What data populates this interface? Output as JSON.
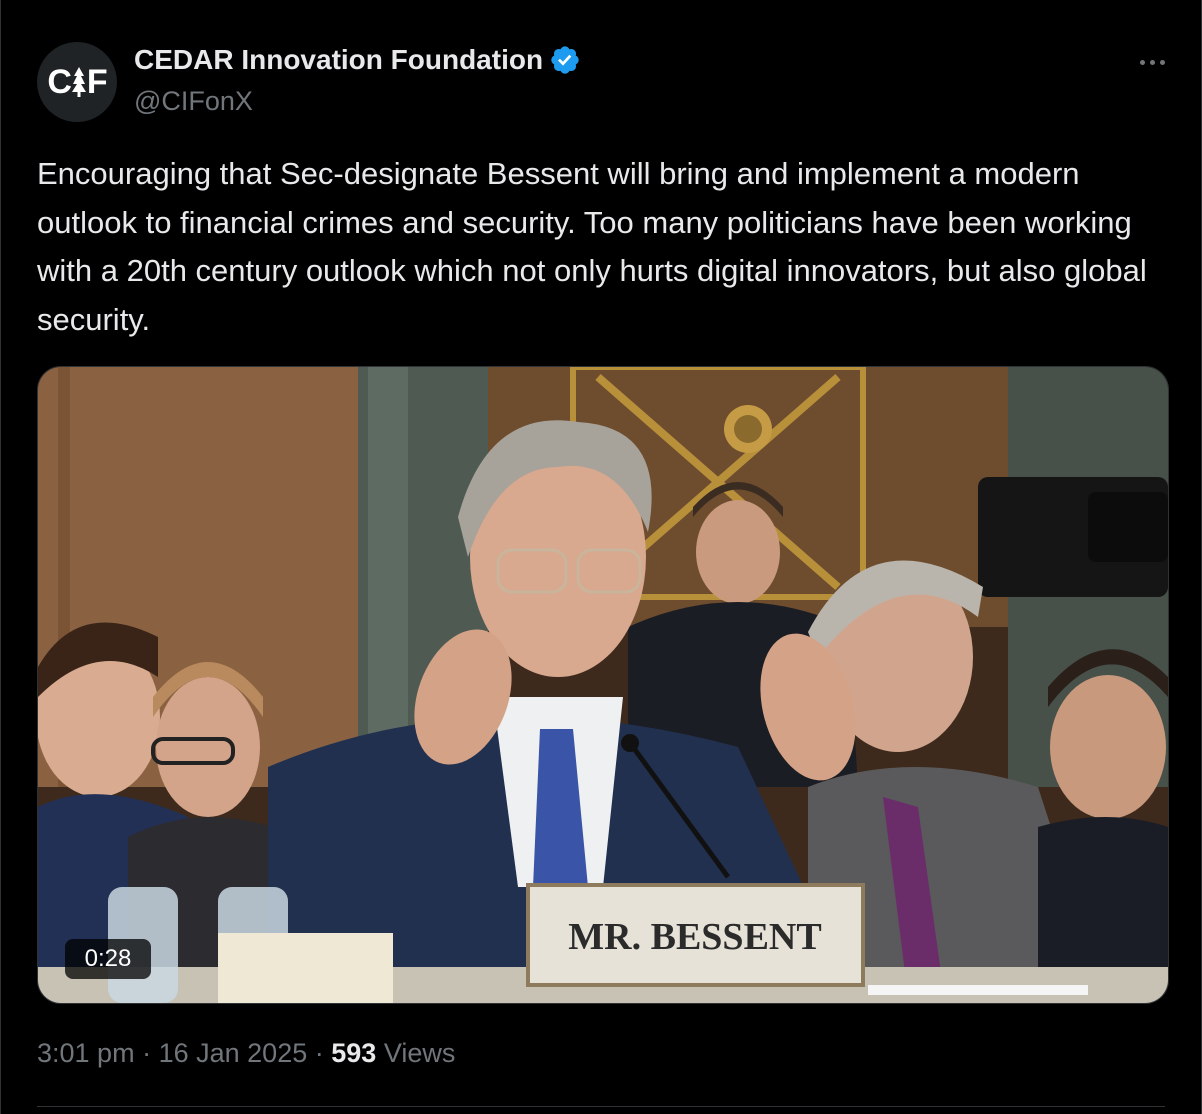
{
  "account": {
    "name": "CEDAR Innovation Foundation",
    "handle": "@CIFonX",
    "avatar_text_left": "C",
    "avatar_text_right": "F",
    "verified": true,
    "verified_color": "#1d9bf0"
  },
  "tweet": {
    "text": "Encouraging that Sec-designate Bessent will bring and implement a modern outlook to financial crimes and security. Too many politicians have been working with a 20th century outlook which not only hurts digital innovators, but also global security.",
    "time": "3:01 pm",
    "date": "16 Jan 2025",
    "views_count": "593",
    "views_label": "Views",
    "separator": "·"
  },
  "media": {
    "type": "video",
    "duration": "0:28",
    "nameplate": "MR. BESSENT"
  },
  "icons": {
    "more": "more-horizontal-icon",
    "verified": "verified-badge-icon"
  }
}
